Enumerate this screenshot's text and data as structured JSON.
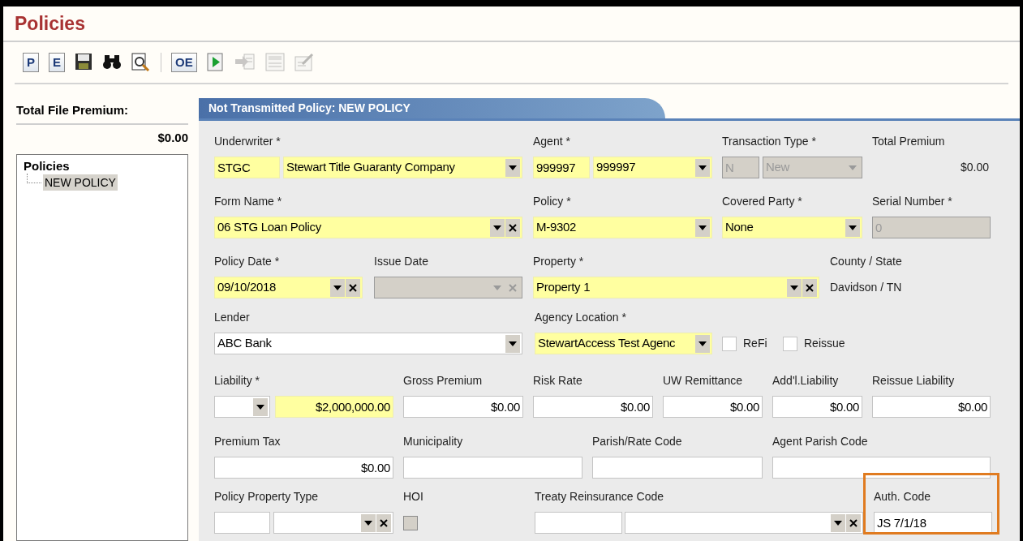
{
  "page": {
    "title": "Policies"
  },
  "toolbar": [
    {
      "kind": "letter",
      "label": "P",
      "disabled": false
    },
    {
      "kind": "letter",
      "label": "E",
      "disabled": false
    },
    {
      "kind": "save",
      "disabled": false
    },
    {
      "kind": "find",
      "disabled": false
    },
    {
      "kind": "preview",
      "disabled": false
    },
    {
      "kind": "separator"
    },
    {
      "kind": "letter",
      "label": "OE",
      "disabled": false
    },
    {
      "kind": "run",
      "disabled": false
    },
    {
      "kind": "transmit",
      "disabled": true
    },
    {
      "kind": "void",
      "disabled": true
    },
    {
      "kind": "edit",
      "disabled": true
    }
  ],
  "sidebar": {
    "title": "Total File Premium:",
    "amount": "$0.00",
    "tree": {
      "label": "Policies",
      "children": [
        {
          "label": "NEW POLICY",
          "selected": true
        }
      ]
    }
  },
  "form": {
    "title": "Not Transmitted Policy: NEW POLICY",
    "rows": [
      {
        "fields": [
          {
            "label": "Underwriter *",
            "parts": [
              {
                "kind": "input",
                "value": "STGC",
                "required": true,
                "disabled": false
              },
              {
                "kind": "select",
                "value": "Stewart Title Guaranty Company",
                "required": true,
                "disabled": false,
                "clearable": false
              }
            ]
          },
          {
            "label": "Agent *",
            "parts": [
              {
                "kind": "input",
                "value": "999997",
                "required": true,
                "disabled": false
              },
              {
                "kind": "select",
                "value": "999997",
                "required": true,
                "disabled": false,
                "clearable": false
              }
            ]
          },
          {
            "label": "Transaction Type *",
            "parts": [
              {
                "kind": "input",
                "value": "N",
                "disabled": true
              },
              {
                "kind": "select",
                "value": "New",
                "disabled": true,
                "clearable": false
              }
            ]
          },
          {
            "label": "Total Premium",
            "parts": [
              {
                "kind": "value",
                "value": "$0.00"
              }
            ]
          }
        ]
      },
      {
        "fields": [
          {
            "label": "Form Name *",
            "parts": [
              {
                "kind": "select",
                "value": "06 STG Loan Policy",
                "required": true,
                "disabled": false,
                "clearable": true
              }
            ]
          },
          {
            "label": "Policy *",
            "parts": [
              {
                "kind": "select",
                "value": "M-9302",
                "required": true,
                "disabled": false,
                "clearable": false
              }
            ]
          },
          {
            "label": "Covered Party *",
            "parts": [
              {
                "kind": "select",
                "value": "None",
                "required": true,
                "disabled": false,
                "clearable": false
              }
            ]
          },
          {
            "label": "Serial Number *",
            "parts": [
              {
                "kind": "input",
                "value": "0",
                "disabled": true
              }
            ]
          }
        ]
      },
      {
        "fields": [
          {
            "label": "Policy Date *",
            "parts": [
              {
                "kind": "select",
                "value": "09/10/2018",
                "required": true,
                "disabled": false,
                "clearable": true
              }
            ]
          },
          {
            "label": "Issue Date",
            "parts": [
              {
                "kind": "select",
                "disabled": true,
                "clearable": true
              }
            ]
          },
          {
            "label": "Property *",
            "parts": [
              {
                "kind": "select",
                "value": "Property 1",
                "required": true,
                "disabled": false,
                "clearable": true
              }
            ]
          },
          {
            "label": "County / State",
            "parts": [
              {
                "kind": "value",
                "value": "Davidson / TN"
              }
            ]
          }
        ]
      },
      {
        "fields": [
          {
            "label": "Lender",
            "parts": [
              {
                "kind": "select",
                "value": "ABC Bank",
                "required": false,
                "disabled": false,
                "clearable": false
              }
            ]
          },
          {
            "label": "Agency Location *",
            "parts": [
              {
                "kind": "select",
                "value": "StewartAccess Test Agenc",
                "required": true,
                "disabled": false,
                "clearable": false
              }
            ]
          },
          {
            "parts": [
              {
                "kind": "checkbox",
                "label": "ReFi",
                "checked": false,
                "disabled": false
              }
            ]
          },
          {
            "parts": [
              {
                "kind": "checkbox",
                "label": "Reissue",
                "checked": false,
                "disabled": false
              }
            ]
          }
        ]
      },
      {
        "fields": [
          {
            "label": "Liability *",
            "parts": [
              {
                "kind": "select",
                "required": false,
                "disabled": false,
                "clearable": false
              },
              {
                "kind": "amount",
                "value": "$2,000,000.00",
                "required": true,
                "disabled": false
              }
            ]
          },
          {
            "label": "Gross Premium",
            "parts": [
              {
                "kind": "amount",
                "value": "$0.00",
                "required": false,
                "disabled": false
              }
            ]
          },
          {
            "label": "Risk Rate",
            "parts": [
              {
                "kind": "amount",
                "value": "$0.00",
                "required": false,
                "disabled": false
              }
            ]
          },
          {
            "label": "UW Remittance",
            "parts": [
              {
                "kind": "amount",
                "value": "$0.00",
                "required": false,
                "disabled": false
              }
            ]
          },
          {
            "label": "Add'l.Liability",
            "parts": [
              {
                "kind": "amount",
                "value": "$0.00",
                "required": false,
                "disabled": false
              }
            ]
          },
          {
            "label": "Reissue Liability",
            "parts": [
              {
                "kind": "amount",
                "value": "$0.00",
                "required": false,
                "disabled": false
              }
            ]
          }
        ]
      },
      {
        "fields": [
          {
            "label": "Premium Tax",
            "parts": [
              {
                "kind": "amount",
                "value": "$0.00",
                "required": false,
                "disabled": false
              }
            ]
          },
          {
            "label": "Municipality",
            "parts": [
              {
                "kind": "input",
                "required": false,
                "disabled": false
              }
            ]
          },
          {
            "label": "Parish/Rate Code",
            "parts": [
              {
                "kind": "input",
                "required": false,
                "disabled": false
              }
            ]
          },
          {
            "label": "Agent Parish Code",
            "parts": [
              {
                "kind": "input",
                "required": false,
                "disabled": false
              }
            ]
          }
        ]
      },
      {
        "fields": [
          {
            "label": "Policy Property Type",
            "parts": [
              {
                "kind": "input",
                "required": false,
                "disabled": false
              },
              {
                "kind": "select",
                "required": false,
                "disabled": false,
                "clearable": true
              }
            ]
          },
          {
            "label": "HOI",
            "parts": [
              {
                "kind": "checkbox",
                "checked": false,
                "disabled": true
              }
            ]
          },
          {
            "label": "Treaty Reinsurance Code",
            "parts": [
              {
                "kind": "input",
                "required": false,
                "disabled": false
              },
              {
                "kind": "select",
                "required": false,
                "disabled": false,
                "clearable": true
              }
            ]
          },
          {
            "label": "Auth. Code",
            "highlighted": true,
            "parts": [
              {
                "kind": "input",
                "value": "JS 7/1/18",
                "required": false,
                "disabled": false
              }
            ]
          }
        ]
      }
    ]
  }
}
